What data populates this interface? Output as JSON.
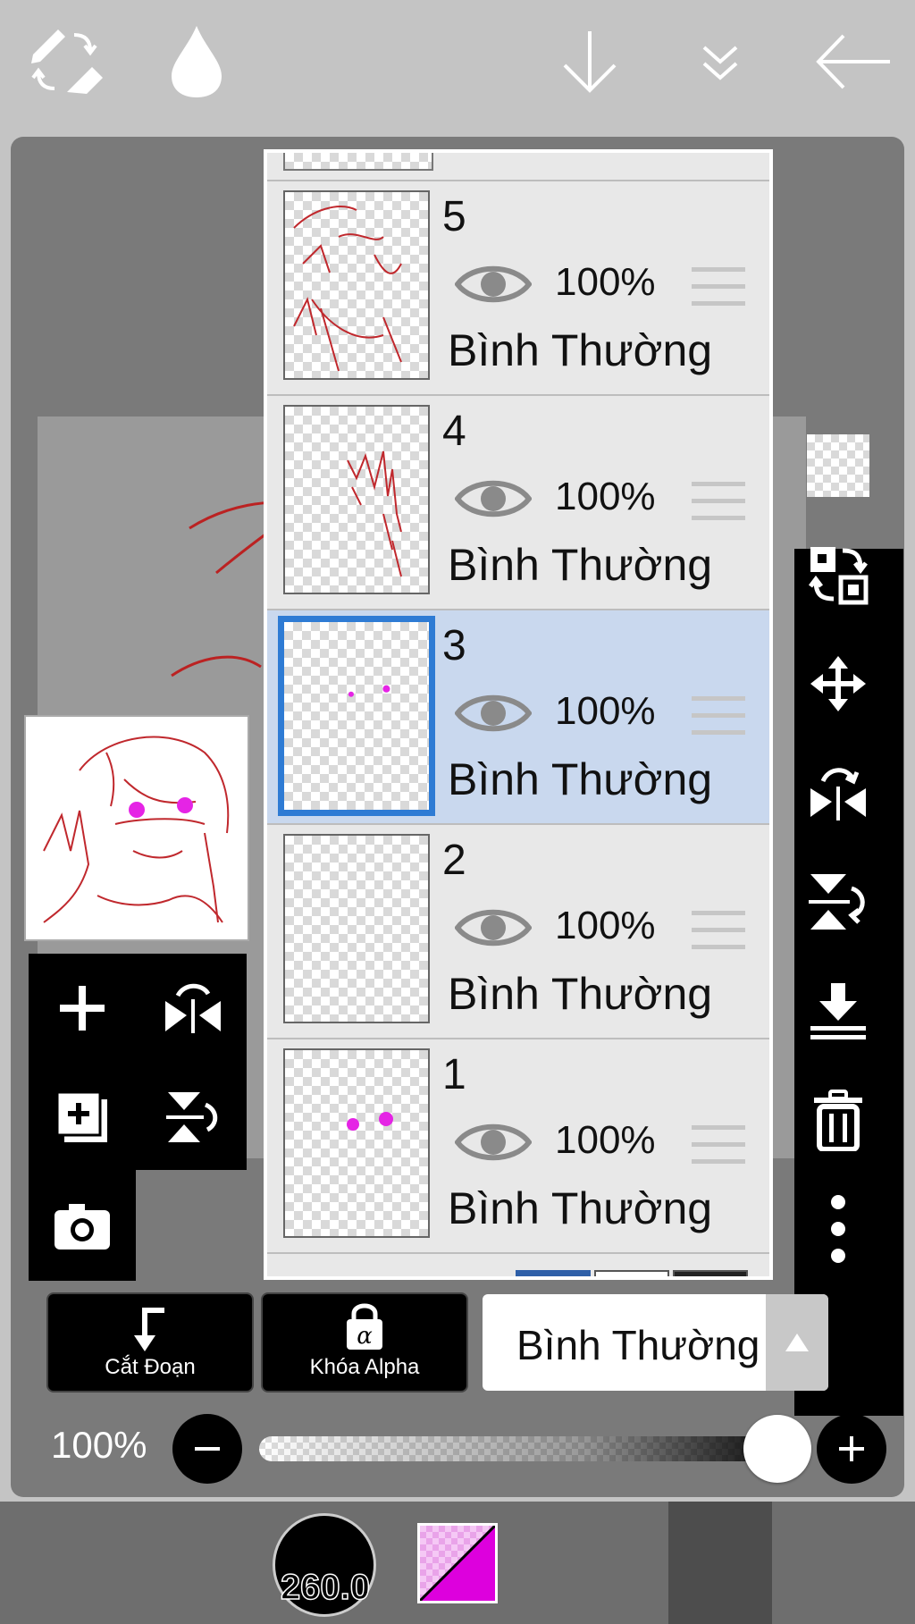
{
  "layers": [
    {
      "number": "5",
      "opacity": "100%",
      "blend": "Bình Thường",
      "selected": false
    },
    {
      "number": "4",
      "opacity": "100%",
      "blend": "Bình Thường",
      "selected": false
    },
    {
      "number": "3",
      "opacity": "100%",
      "blend": "Bình Thường",
      "selected": true
    },
    {
      "number": "2",
      "opacity": "100%",
      "blend": "Bình Thường",
      "selected": false
    },
    {
      "number": "1",
      "opacity": "100%",
      "blend": "Bình Thường",
      "selected": false
    }
  ],
  "controls": {
    "clipping_label": "Cắt Đoạn",
    "alpha_lock_label": "Khóa Alpha",
    "blend_mode": "Bình Thường",
    "opacity_label": "100%"
  },
  "bottom_bar": {
    "brush_size": "260.0",
    "primary_color": "#dd00dd",
    "secondary_color": "transparent"
  },
  "icons": {
    "right_toolbar": [
      "transparent-layer-icon",
      "swap-layer-icon",
      "move-icon",
      "flip-horizontal-icon",
      "flip-vertical-icon",
      "merge-down-icon",
      "trash-icon",
      "more-icon"
    ],
    "left_toolbar": [
      "add-layer-icon",
      "flip-horizontal-icon",
      "duplicate-layer-icon",
      "flip-vertical-icon",
      "camera-icon"
    ]
  }
}
